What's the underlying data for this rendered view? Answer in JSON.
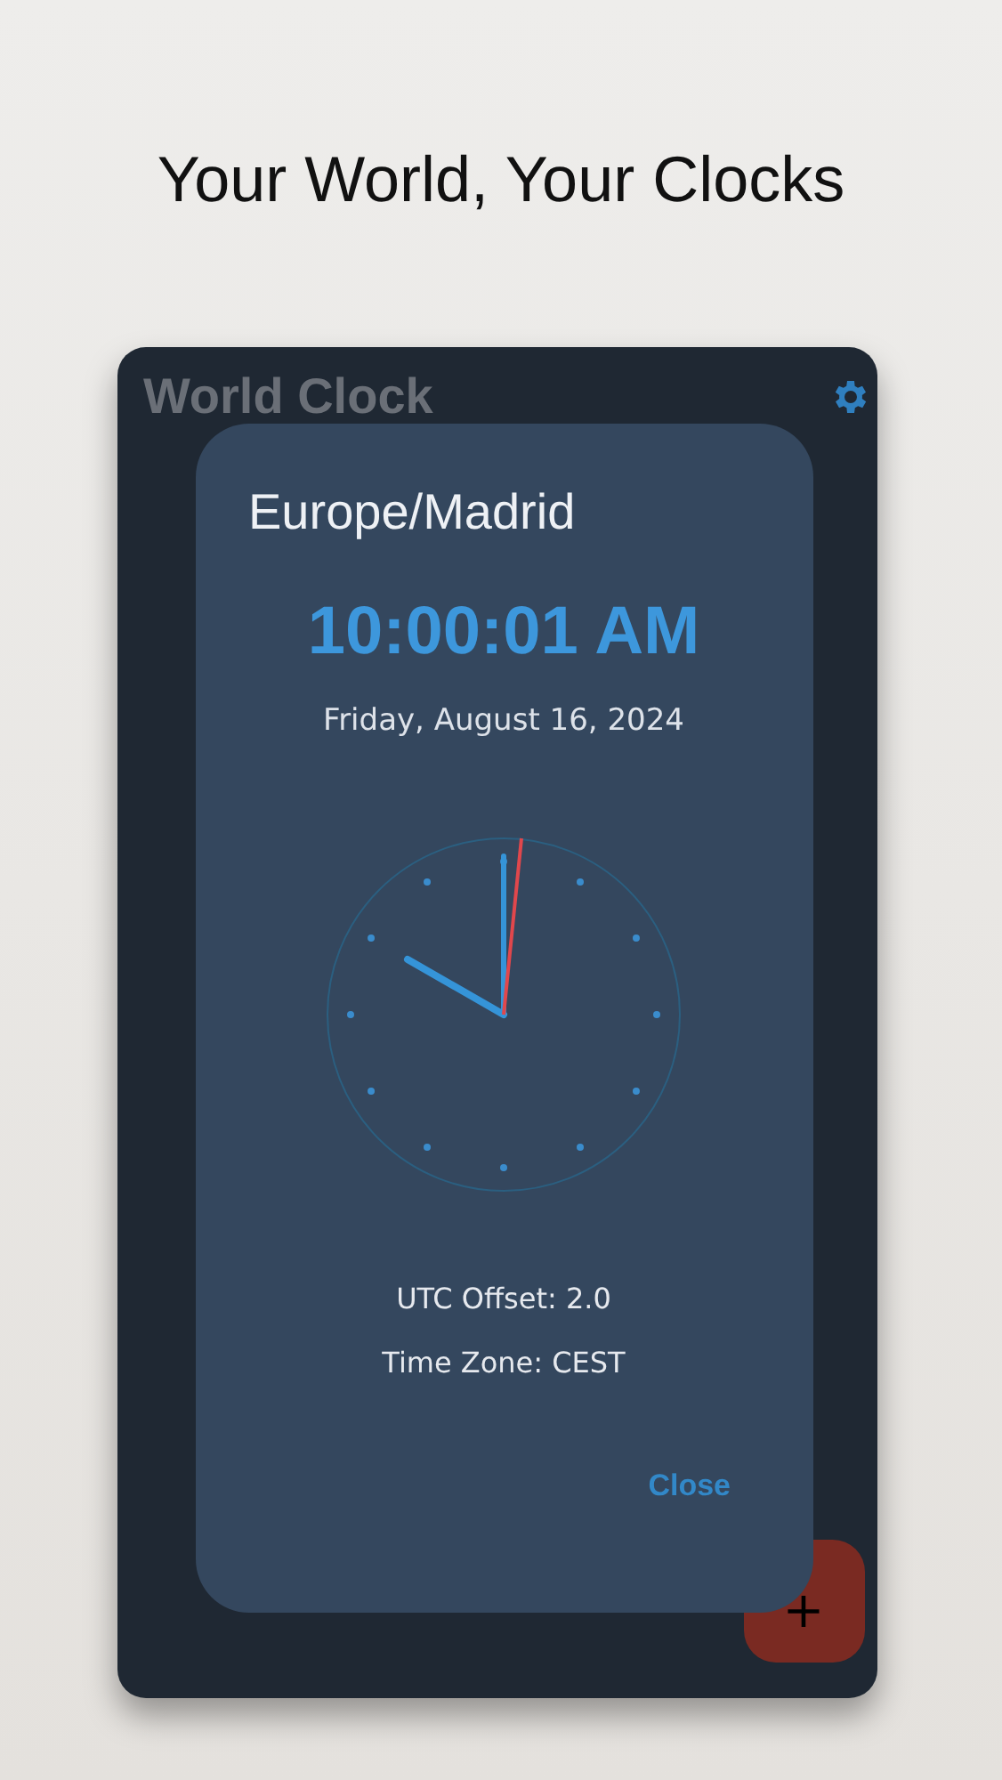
{
  "headline": "Your World, Your Clocks",
  "app": {
    "title": "World Clock"
  },
  "dialog": {
    "zone": "Europe/Madrid",
    "time": "10:00:01 AM",
    "date": "Friday, August 16, 2024",
    "details": [
      "UTC Offset: 2.0",
      "Time Zone: CEST"
    ],
    "close": "Close"
  },
  "fab": {
    "label": "+"
  }
}
